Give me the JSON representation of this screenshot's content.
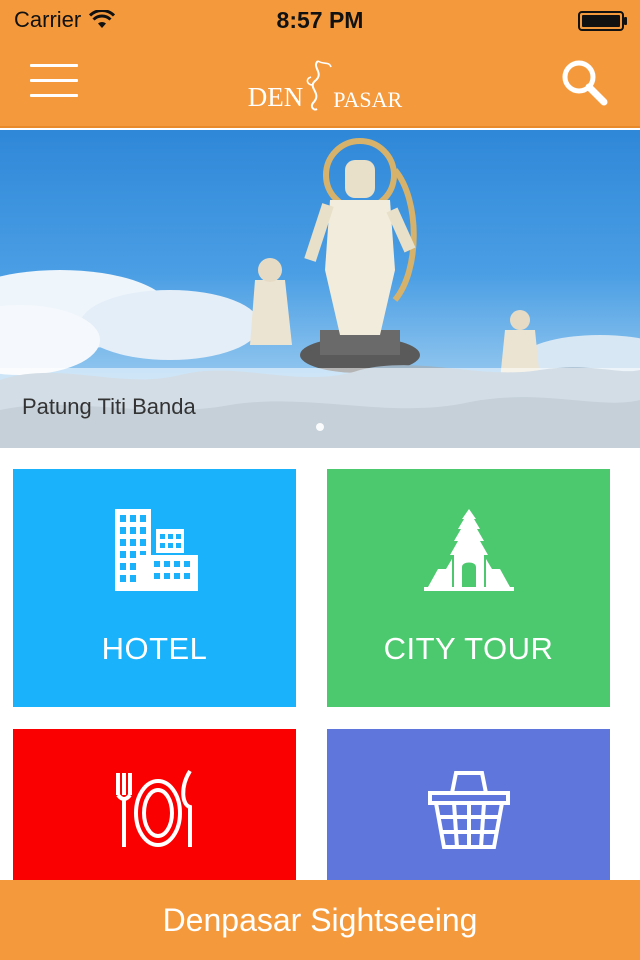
{
  "status_bar": {
    "carrier": "Carrier",
    "time": "8:57 PM",
    "wifi_icon": "wifi-icon",
    "battery_icon": "battery-icon"
  },
  "nav_bar": {
    "logo_prefix": "DEN",
    "logo_suffix": "PASAR",
    "menu_icon": "hamburger-menu-icon",
    "search_icon": "search-icon",
    "background_color": "#f59a3c"
  },
  "hero": {
    "caption": "Patung Titi Banda",
    "slide_count": 1
  },
  "tiles": [
    {
      "label": "HOTEL",
      "icon": "hotel-building-icon",
      "color": "#1ab3fb"
    },
    {
      "label": "CITY TOUR",
      "icon": "temple-gate-icon",
      "color": "#4cc96e"
    },
    {
      "label": "",
      "icon": "fork-plate-knife-icon",
      "color": "#fb0000"
    },
    {
      "label": "",
      "icon": "shopping-basket-icon",
      "color": "#5f76dd"
    }
  ],
  "bottom_bar": {
    "title": "Denpasar Sightseeing"
  }
}
